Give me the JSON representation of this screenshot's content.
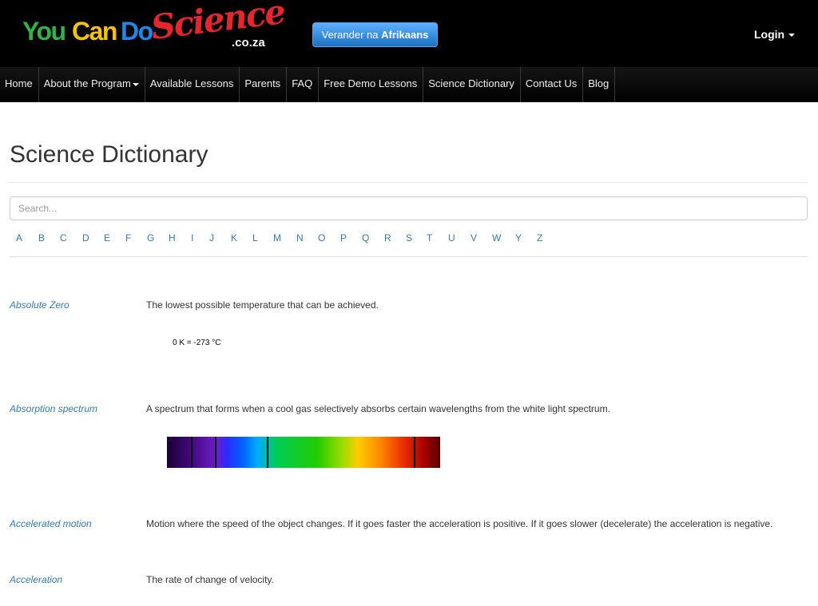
{
  "header": {
    "logo": {
      "you": "You",
      "can": "Can",
      "do": "Do",
      "science": "Science",
      "coza": ".co.za"
    },
    "language_button": {
      "prefix": "Verander na",
      "bold": "Afrikaans"
    },
    "login_label": "Login"
  },
  "nav": {
    "items": [
      {
        "label": "Home"
      },
      {
        "label": "About the Program"
      },
      {
        "label": "Available Lessons"
      },
      {
        "label": "Parents"
      },
      {
        "label": "FAQ"
      },
      {
        "label": "Free Demo Lessons"
      },
      {
        "label": "Science Dictionary"
      },
      {
        "label": "Contact Us"
      },
      {
        "label": "Blog"
      }
    ]
  },
  "page": {
    "title": "Science Dictionary",
    "search_placeholder": "Search..."
  },
  "alphabet": [
    "A",
    "B",
    "C",
    "D",
    "E",
    "F",
    "G",
    "H",
    "I",
    "J",
    "K",
    "L",
    "M",
    "N",
    "O",
    "P",
    "Q",
    "R",
    "S",
    "T",
    "U",
    "V",
    "W",
    "Y",
    "Z"
  ],
  "entries": [
    {
      "term": "Absolute Zero",
      "definition": "The lowest possible temperature that can be achieved.",
      "formula": "0 K = -273 °C"
    },
    {
      "term": "Absorption spectrum",
      "definition": "A spectrum that forms when a cool gas selectively absorbs certain wavelengths from the white light spectrum."
    },
    {
      "term": "Accelerated motion",
      "definition": "Motion where the speed of the object changes. If it goes faster the acceleration is positive. If it goes slower (decelerate) the acceleration is negative."
    },
    {
      "term": "Acceleration",
      "definition": "The rate of change of velocity."
    }
  ],
  "colors": {
    "header_bg": "#000000",
    "link": "#337ab7",
    "button_blue": "#2c7fd6",
    "logo_green": "#2fb34a",
    "logo_yellow": "#f5c400",
    "logo_blue": "#1e88e5",
    "logo_red": "#e5262b"
  }
}
